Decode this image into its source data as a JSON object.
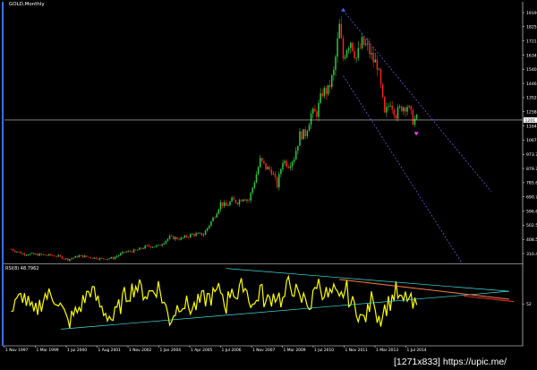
{
  "window": {
    "title": "GOLD,Monthly"
  },
  "indicator": {
    "label": "RSI(8) 48.7962"
  },
  "price": {
    "current": "1201.4"
  },
  "watermark": {
    "text": "[1271x833] https://upic.me/"
  },
  "colors": {
    "bull": "#2ECC40",
    "bear": "#FF2020",
    "rsi": "#FFFF00",
    "grid": "#FFFFFF",
    "channel": "#6A6AFF",
    "trend_up": "#40E0E0",
    "trend_down": "#FF8040",
    "trend_short": "#FF3030",
    "arrow_up": "#4060FF",
    "arrow_down": "#FF40FF"
  },
  "chart_data": [
    {
      "type": "candlestick",
      "panel": "price",
      "y_ticks": [
        "1919.9",
        "1825.0",
        "1721.0",
        "1634.0",
        "1540.0",
        "1446.0",
        "1352.0",
        "1258.0",
        "1164.0",
        "1067.7",
        "973.70",
        "879.70",
        "785.60",
        "690.70",
        "596.65",
        "502.55",
        "408.55",
        "310.45"
      ],
      "ylim": [
        240,
        1975
      ],
      "x": [
        1997.0,
        1997.5,
        1998.0,
        1998.5,
        1999.0,
        1999.5,
        2000.0,
        2000.5,
        2001.0,
        2001.5,
        2002.0,
        2002.5,
        2003.0,
        2003.5,
        2004.0,
        2004.5,
        2005.0,
        2005.5,
        2006.0,
        2006.25,
        2006.5,
        2006.75,
        2007.0,
        2007.25,
        2007.5,
        2007.75,
        2008.0,
        2008.25,
        2008.5,
        2008.75,
        2009.0,
        2009.25,
        2009.5,
        2009.75,
        2010.0,
        2010.25,
        2010.5,
        2010.75,
        2011.0,
        2011.25,
        2011.5,
        2011.67,
        2011.83,
        2012.0,
        2012.25,
        2012.5,
        2012.75,
        2013.0,
        2013.17,
        2013.33,
        2013.5,
        2013.75,
        2014.0,
        2014.25,
        2014.5,
        2014.75,
        2015.0
      ],
      "close": [
        330,
        300,
        295,
        290,
        285,
        260,
        285,
        275,
        265,
        270,
        310,
        320,
        350,
        350,
        410,
        400,
        430,
        430,
        560,
        640,
        620,
        660,
        650,
        680,
        660,
        790,
        930,
        880,
        860,
        760,
        930,
        900,
        950,
        1100,
        1110,
        1240,
        1250,
        1390,
        1400,
        1520,
        1830,
        1620,
        1700,
        1740,
        1620,
        1720,
        1690,
        1600,
        1580,
        1420,
        1230,
        1330,
        1240,
        1290,
        1300,
        1200,
        1210
      ]
    },
    {
      "type": "line",
      "panel": "indicator",
      "series": [
        {
          "name": "RSI(8) 48.7962",
          "values": [
            42,
            64,
            38,
            63,
            60,
            28,
            46,
            71,
            46,
            32,
            61,
            75,
            64,
            74,
            32,
            55,
            46,
            58,
            63,
            70,
            50,
            75,
            58,
            80,
            61,
            48,
            72,
            52,
            61,
            65,
            54,
            77,
            72,
            55,
            60,
            48,
            81,
            70,
            61,
            66,
            54,
            67,
            70,
            52,
            48,
            31,
            40,
            66,
            37,
            36,
            46,
            55,
            68,
            52,
            62,
            48,
            49
          ]
        }
      ],
      "y_ticks": [
        "52"
      ],
      "ylim": [
        0,
        100
      ]
    }
  ],
  "x_ticks": [
    "1 Nov 1997",
    "1 Mar 1999",
    "1 Jul 2000",
    "1 Aug 2001",
    "1 Nov 2002",
    "1 Jan 2004",
    "1 Apr 2005",
    "1 Jul 2006",
    "1 Nov 2007",
    "1 Mar 2009",
    "1 Jul 2010",
    "1 Nov 2011",
    "1 Mar 2013",
    "1 Jul 2014"
  ]
}
